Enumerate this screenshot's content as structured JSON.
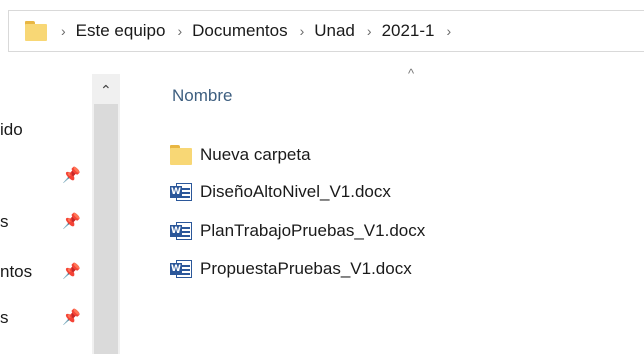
{
  "breadcrumb": {
    "folder_icon": "folder-icon",
    "separator": "›",
    "items": [
      "Este equipo",
      "Documentos",
      "Unad",
      "2021-1"
    ]
  },
  "nav": {
    "items": [
      {
        "label": "ido",
        "pinned": false
      },
      {
        "label": "",
        "pinned": true
      },
      {
        "label": "s",
        "pinned": true
      },
      {
        "label": "ntos",
        "pinned": true
      },
      {
        "label": "s",
        "pinned": true
      }
    ],
    "pin_icon": "pin-icon"
  },
  "file_list": {
    "sort_indicator": "^",
    "column_header": "Nombre",
    "files": [
      {
        "name": "Nueva carpeta",
        "type": "folder"
      },
      {
        "name": "DiseñoAltoNivel_V1.docx",
        "type": "word"
      },
      {
        "name": "PlanTrabajoPruebas_V1.docx",
        "type": "word"
      },
      {
        "name": "PropuestaPruebas_V1.docx",
        "type": "word"
      }
    ]
  },
  "colors": {
    "folder": "#f8d775",
    "word": "#2b579a",
    "header_text": "#3e5f80",
    "scrollbar": "#f0f0f0"
  }
}
